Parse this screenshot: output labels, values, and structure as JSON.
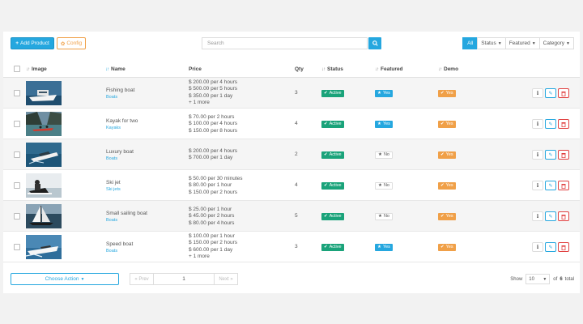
{
  "toolbar": {
    "add_label": "Add Product",
    "config_label": "Config",
    "search_placeholder": "Search",
    "filters": [
      {
        "label": "All",
        "caret": false
      },
      {
        "label": "Status",
        "caret": true
      },
      {
        "label": "Featured",
        "caret": true
      },
      {
        "label": "Category",
        "caret": true
      }
    ]
  },
  "table": {
    "headers": {
      "image": "Image",
      "name": "Name",
      "price": "Price",
      "qty": "Qty",
      "status": "Status",
      "featured": "Featured",
      "demo": "Demo"
    },
    "rows": [
      {
        "name": "Fishing boat",
        "category": "Boats",
        "prices": [
          "$ 200.00 per 4 hours",
          "$ 500.00 per 5 hours",
          "$ 350.00 per 1 day",
          "+ 1 more"
        ],
        "qty": "3",
        "status": "Active",
        "featured": "Yes",
        "demo": "Yes",
        "thumb": "boat-deck"
      },
      {
        "name": "Kayak for two",
        "category": "Kayaks",
        "prices": [
          "$ 70.00 per 2 hours",
          "$ 100.00 per 4 hours",
          "$ 150.00 per 8 hours"
        ],
        "qty": "4",
        "status": "Active",
        "featured": "Yes",
        "demo": "Yes",
        "thumb": "kayak-fjord"
      },
      {
        "name": "Luxury boat",
        "category": "Boats",
        "prices": [
          "$ 200.00 per 4 hours",
          "$ 700.00 per 1 day"
        ],
        "qty": "2",
        "status": "Active",
        "featured": "No",
        "demo": "Yes",
        "thumb": "luxury-boat"
      },
      {
        "name": "Ski jet",
        "category": "Ski jets",
        "prices": [
          "$ 50.00 per 30 minutes",
          "$ 80.00 per 1 hour",
          "$ 150.00 per 2 hours"
        ],
        "qty": "4",
        "status": "Active",
        "featured": "No",
        "demo": "Yes",
        "thumb": "ski-jet"
      },
      {
        "name": "Small sailing boat",
        "category": "Boats",
        "prices": [
          "$ 25.00 per 1 hour",
          "$ 45.00 per 2 hours",
          "$ 80.00 per 4 hours"
        ],
        "qty": "5",
        "status": "Active",
        "featured": "No",
        "demo": "Yes",
        "thumb": "sailboat"
      },
      {
        "name": "Speed boat",
        "category": "Boats",
        "prices": [
          "$ 100.00 per 1 hour",
          "$ 150.00 per 2 hours",
          "$ 600.00 per 1 day",
          "+ 1 more"
        ],
        "qty": "3",
        "status": "Active",
        "featured": "Yes",
        "demo": "Yes",
        "thumb": "speed-boat"
      }
    ]
  },
  "footer": {
    "choose_action": "Choose Action",
    "prev": "« Prev",
    "page": "1",
    "next": "Next »",
    "show_label": "Show",
    "per_page": "10",
    "of_label": "of",
    "total_pages": "6",
    "total_label": "total"
  },
  "colors": {
    "accent": "#25a7df",
    "active": "#1aa37a",
    "demo": "#f0a048",
    "danger": "#e04040"
  }
}
